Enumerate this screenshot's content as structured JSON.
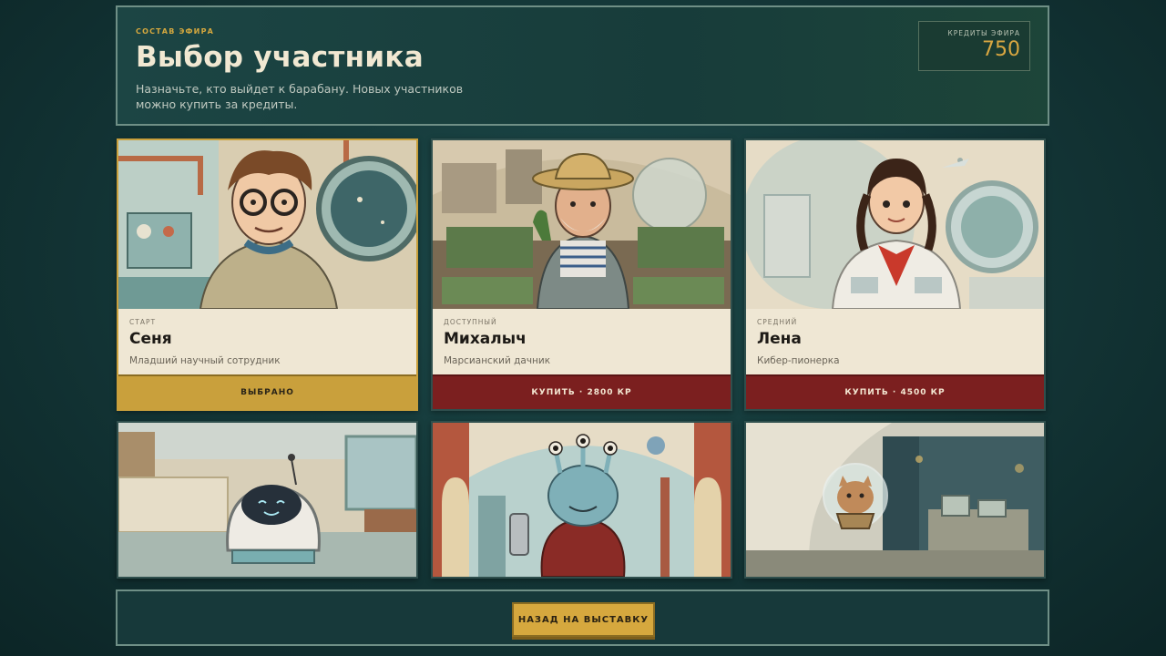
{
  "header": {
    "eyebrow": "СОСТАВ ЭФИРА",
    "title": "Выбор участника",
    "subtitle": "Назначьте, кто выйдет к барабану. Новых участников можно купить за кредиты.",
    "credits_label": "КРЕДИТЫ ЭФИРА",
    "credits_value": "750"
  },
  "cards": [
    {
      "tier": "СТАРТ",
      "name": "Сеня",
      "role": "Младший научный сотрудник",
      "button": "ВЫБРАНО",
      "state": "selected",
      "portrait": "scientist-portrait"
    },
    {
      "tier": "ДОСТУПНЫЙ",
      "name": "Михалыч",
      "role": "Марсианский дачник",
      "button": "КУПИТЬ · 2800 КР",
      "state": "buy",
      "portrait": "gardener-portrait"
    },
    {
      "tier": "СРЕДНИЙ",
      "name": "Лена",
      "role": "Кибер-пионерка",
      "button": "КУПИТЬ · 4500 КР",
      "state": "buy",
      "portrait": "pioneer-girl-portrait"
    },
    {
      "state": "locked",
      "portrait": "robot-portrait"
    },
    {
      "state": "locked",
      "portrait": "alien-portrait"
    },
    {
      "state": "locked",
      "portrait": "cat-in-bubble-portrait"
    }
  ],
  "footer": {
    "back_label": "НАЗАД НА ВЫСТАВКУ"
  },
  "colors": {
    "accent_gold": "#c9a03c",
    "buy_red": "#7b1f1f",
    "background": "#133536"
  }
}
